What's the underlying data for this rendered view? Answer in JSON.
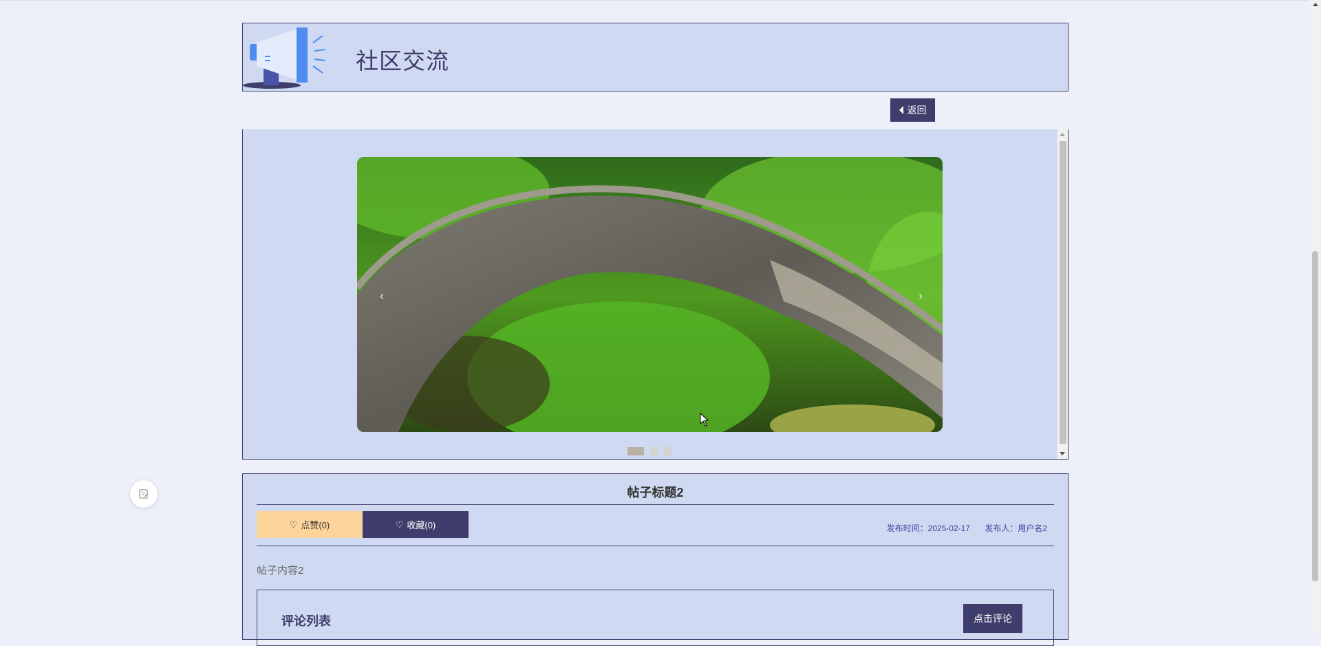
{
  "header": {
    "title": "社区交流",
    "logo_icon": "megaphone-icon",
    "back_label": "返回"
  },
  "carousel": {
    "image_description_icon": "stone-arch-bridge-image",
    "slide_count": 3,
    "active_index": 0
  },
  "post": {
    "title": "帖子标题2",
    "like_label": "点赞(0)",
    "favorite_label": "收藏(0)",
    "publish_time": "发布时间：2025-02-17",
    "publisher": "发布人：用户名2",
    "content": "帖子内容2"
  },
  "comments": {
    "title": "评论列表",
    "comment_button": "点击评论"
  },
  "colors": {
    "accent": "#3f3d6b",
    "panel_bg": "#cfdaf2",
    "like_bg": "#fdd49a"
  }
}
